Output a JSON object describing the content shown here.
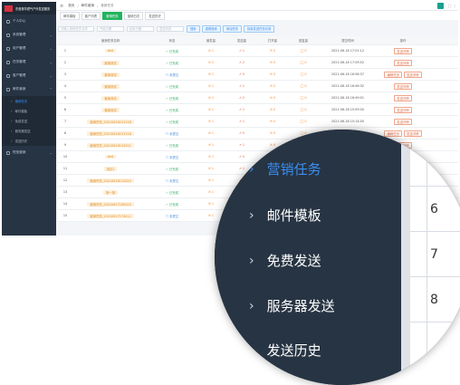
{
  "app": {
    "title": "东营港华燃气户外发送服务"
  },
  "sidebar": {
    "items": [
      {
        "label": "个人中心"
      },
      {
        "label": "系统管理"
      },
      {
        "label": "用户管理"
      },
      {
        "label": "任务管理"
      },
      {
        "label": "客户管理"
      },
      {
        "label": "邮件营销"
      }
    ],
    "subitems": [
      {
        "label": "营销任务"
      },
      {
        "label": "邮件模板"
      },
      {
        "label": "免费发送"
      },
      {
        "label": "服务器发送"
      },
      {
        "label": "发送历史"
      }
    ],
    "footer_item": {
      "label": "短信营销"
    }
  },
  "breadcrumb": {
    "home": "首页",
    "section": "邮件营销",
    "current": "营销任务"
  },
  "tabs": [
    {
      "label": "邮件模板"
    },
    {
      "label": "客户列表"
    },
    {
      "label": "营销任务"
    },
    {
      "label": "营销日志"
    },
    {
      "label": "发送历史"
    }
  ],
  "filters": {
    "task_placeholder": "请输入营销任务名称",
    "start_placeholder": "开始日期",
    "end_placeholder": "结束日期",
    "status_placeholder": "发送状态",
    "search": "搜索",
    "reset": "重置搜索",
    "add": "添加任务",
    "export": "批量发送任务记录"
  },
  "table": {
    "headers": [
      "",
      "营销任务名称",
      "状态",
      "营发量",
      "发送量",
      "打开量",
      "回复量",
      "提交时间",
      "操作"
    ],
    "rows": [
      {
        "n": "1",
        "name": "test",
        "status": "已完成",
        "sent": "1",
        "send": "1",
        "open": "0",
        "reply": "0",
        "time": "2021-06-18 17:01:12",
        "ops": [
          "发送详情"
        ]
      },
      {
        "n": "2",
        "name": "营销测试",
        "status": "已完成",
        "sent": "2",
        "send": "2",
        "open": "0",
        "reply": "0",
        "time": "2021-06-18 17:09:52",
        "ops": [
          "发送详情"
        ]
      },
      {
        "n": "3",
        "name": "营销测试",
        "status": "未提交",
        "sent": "1",
        "send": "0",
        "open": "0",
        "reply": "0",
        "time": "2021-06-18 16:56:37",
        "ops": [
          "编辑任务",
          "发送详情"
        ]
      },
      {
        "n": "4",
        "name": "营销测试",
        "status": "已完成",
        "sent": "1",
        "send": "1",
        "open": "0",
        "reply": "0",
        "time": "2021-06-18 16:46:32",
        "ops": [
          "发送详情"
        ]
      },
      {
        "n": "5",
        "name": "营销测试",
        "status": "已完成",
        "sent": "2",
        "send": "2",
        "open": "0",
        "reply": "0",
        "time": "2021-06-18 16:49:01",
        "ops": [
          "发送详情"
        ]
      },
      {
        "n": "6",
        "name": "营销测试",
        "status": "已完成",
        "sent": "1",
        "send": "1",
        "open": "0",
        "reply": "0",
        "time": "2021-06-18 15:59:00",
        "ops": [
          "发送详情"
        ]
      },
      {
        "n": "7",
        "name": "营销任务_20210618151118",
        "status": "已完成",
        "sent": "1",
        "send": "1",
        "open": "0",
        "reply": "0",
        "time": "2021-06-18 15:14:00",
        "ops": [
          "发送详情"
        ]
      },
      {
        "n": "8",
        "name": "营销任务_20210618151118",
        "status": "未提交",
        "sent": "1",
        "send": "0",
        "open": "0",
        "reply": "0",
        "time": "2021-06-18 15:11:18",
        "ops": [
          "编辑任务",
          "发送详情"
        ]
      },
      {
        "n": "9",
        "name": "营销任务_20210618143251",
        "status": "已完成",
        "sent": "1",
        "send": "1",
        "open": "0",
        "reply": "0",
        "time": "2021-06-18 14:33:02",
        "ops": [
          "发送详情"
        ]
      },
      {
        "n": "10",
        "name": "test",
        "status": "未提交",
        "sent": "1",
        "send": "0",
        "open": "0",
        "reply": "0",
        "time": "2021-06-18 14:02:45",
        "ops": [
          "编辑任务"
        ]
      },
      {
        "n": "11",
        "name": "测试1",
        "status": "已完成",
        "sent": "1",
        "send": "1",
        "open": "0",
        "reply": "0",
        "time": "2021-06-18 13:55:10",
        "ops": [
          "发送详情"
        ]
      },
      {
        "n": "12",
        "name": "营销任务_20210618112020",
        "status": "未提交",
        "sent": "1",
        "send": "0",
        "open": "0",
        "reply": "0",
        "time": "2021-06-18 11:20:20",
        "ops": [
          "编辑任务"
        ]
      },
      {
        "n": "13",
        "name": "测一测",
        "status": "已完成",
        "sent": "1",
        "send": "1",
        "open": "0",
        "reply": "0",
        "time": "2021-06-18 10:44:31",
        "ops": [
          "发送详情"
        ]
      },
      {
        "n": "14",
        "name": "营销任务_20210617185025",
        "status": "已完成",
        "sent": "1",
        "send": "1",
        "open": "0",
        "reply": "0",
        "time": "2021-06-17 18:50:25",
        "ops": [
          "发送详情"
        ]
      },
      {
        "n": "15",
        "name": "营销任务_20210617174411",
        "status": "未提交",
        "sent": "1",
        "send": "0",
        "open": "0",
        "reply": "0",
        "time": "2021-06-17 17:44:11",
        "ops": [
          "编辑任务"
        ]
      }
    ]
  },
  "magnifier": {
    "menu": [
      {
        "label": "营销任务",
        "active": true
      },
      {
        "label": "邮件模板"
      },
      {
        "label": "免费发送"
      },
      {
        "label": "服务器发送"
      },
      {
        "label": "发送历史"
      }
    ],
    "values": [
      "6",
      "7",
      "8"
    ]
  },
  "colors": {
    "sidebar": "#273443",
    "accent": "#3b8ef0",
    "success": "#22b35e",
    "tag": "#e0902e",
    "danger": "#e2673f"
  }
}
